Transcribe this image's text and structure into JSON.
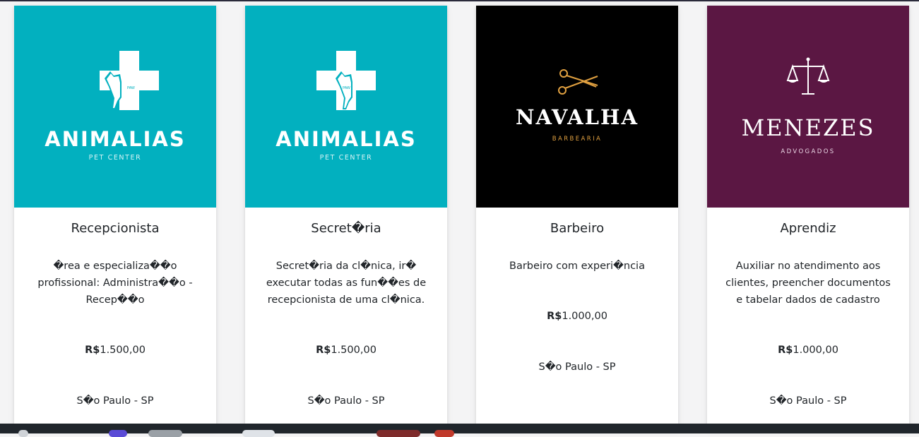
{
  "colors": {
    "teal": "#02b0bf",
    "black": "#000000",
    "plum": "#5b1743",
    "navalha_accent": "#e0a040"
  },
  "cards": [
    {
      "logo": {
        "brand": "ANIMALIAS",
        "sub": "PET CENTER",
        "icon": "vet-cross-dog-icon",
        "background": "#02b0bf"
      },
      "title": "Recepcionista",
      "description": "�rea e especializa��o profissional: Administra��o - Recep��o",
      "currency": "R$",
      "amount": "1.500,00",
      "location": "S�o Paulo - SP"
    },
    {
      "logo": {
        "brand": "ANIMALIAS",
        "sub": "PET CENTER",
        "icon": "vet-cross-dog-icon",
        "background": "#02b0bf"
      },
      "title": "Secret�ria",
      "description": "Secret�ria da cl�nica, ir� executar todas as fun��es de recepcionista de uma cl�nica.",
      "currency": "R$",
      "amount": "1.500,00",
      "location": "S�o Paulo - SP"
    },
    {
      "logo": {
        "brand": "NAVALHA",
        "sub": "BARBEARIA",
        "icon": "scissors-icon",
        "background": "#000000"
      },
      "title": "Barbeiro",
      "description": "Barbeiro com experi�ncia",
      "currency": "R$",
      "amount": "1.000,00",
      "location": "S�o Paulo - SP"
    },
    {
      "logo": {
        "brand": "MENEZES",
        "sub": "ADVOGADOS",
        "icon": "scales-of-justice-icon",
        "background": "#5b1743"
      },
      "title": "Aprendiz",
      "description": "Auxiliar no atendimento aos clientes, preencher documentos e tabelar dados de cadastro",
      "currency": "R$",
      "amount": "1.000,00",
      "location": "S�o Paulo - SP"
    }
  ]
}
